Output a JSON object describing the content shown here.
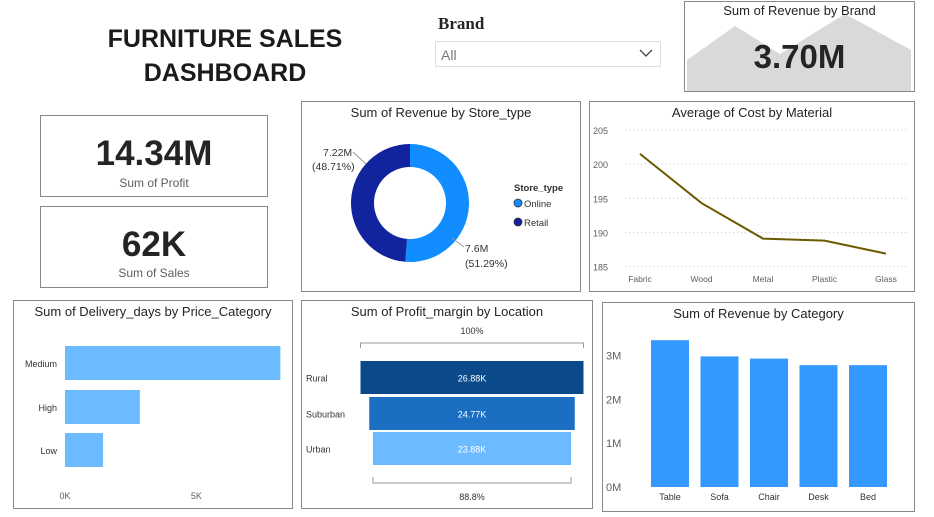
{
  "title": "FURNITURE SALES DASHBOARD",
  "slicer": {
    "title": "Brand",
    "value": "All"
  },
  "brand_card": {
    "title": "Sum of Revenue by Brand",
    "value": "3.70M"
  },
  "kpis": {
    "profit": {
      "value": "14.34M",
      "label": "Sum of Profit"
    },
    "sales": {
      "value": "62K",
      "label": "Sum of Sales"
    }
  },
  "colors": {
    "online": "#118dff",
    "retail": "#12239e",
    "light_blue": "#6cbaff",
    "line": "#6b5a00",
    "funnel": [
      "#0a4a8a",
      "#1b6ec2",
      "#6cbaff"
    ],
    "category_bar": "#3399ff"
  },
  "chart_data": [
    {
      "id": "donut",
      "type": "pie",
      "title": "Sum of Revenue by Store_type",
      "legend_title": "Store_type",
      "legend_position": "right",
      "slices": [
        {
          "name": "Online",
          "value": 7.6,
          "label": "7.6M",
          "pct": "(51.29%)"
        },
        {
          "name": "Retail",
          "value": 7.22,
          "label": "7.22M",
          "pct": "(48.71%)"
        }
      ]
    },
    {
      "id": "line",
      "type": "line",
      "title": "Average of Cost by Material",
      "categories": [
        "Fabric",
        "Wood",
        "Metal",
        "Plastic",
        "Glass"
      ],
      "values": [
        201.5,
        194.3,
        189.1,
        188.8,
        186.9
      ],
      "yticks": [
        "205",
        "200",
        "195",
        "190",
        "185"
      ],
      "ylim": [
        184.5,
        205
      ],
      "grid": true
    },
    {
      "id": "hbar",
      "type": "bar",
      "title": "Sum of Delivery_days by Price_Category",
      "categories": [
        "Medium",
        "High",
        "Low"
      ],
      "values": [
        8200,
        2850,
        1450
      ],
      "xticks": [
        "0K",
        "5K"
      ],
      "xlim": [
        0,
        8300
      ]
    },
    {
      "id": "funnel",
      "type": "bar",
      "title": "Sum of Profit_margin by Location",
      "categories": [
        "Rural",
        "Suburban",
        "Urban"
      ],
      "values": [
        26.88,
        24.77,
        23.88
      ],
      "labels": [
        "26.88K",
        "24.77K",
        "23.88K"
      ],
      "top_label": "100%",
      "bottom_label": "88.8%"
    },
    {
      "id": "vbar",
      "type": "bar",
      "title": "Sum of Revenue by Category",
      "categories": [
        "Table",
        "Sofa",
        "Chair",
        "Desk",
        "Bed"
      ],
      "values": [
        3.35,
        2.98,
        2.93,
        2.78,
        2.78
      ],
      "yticks": [
        "3M",
        "2M",
        "1M",
        "0M"
      ],
      "ylim": [
        0,
        3.4
      ]
    }
  ]
}
